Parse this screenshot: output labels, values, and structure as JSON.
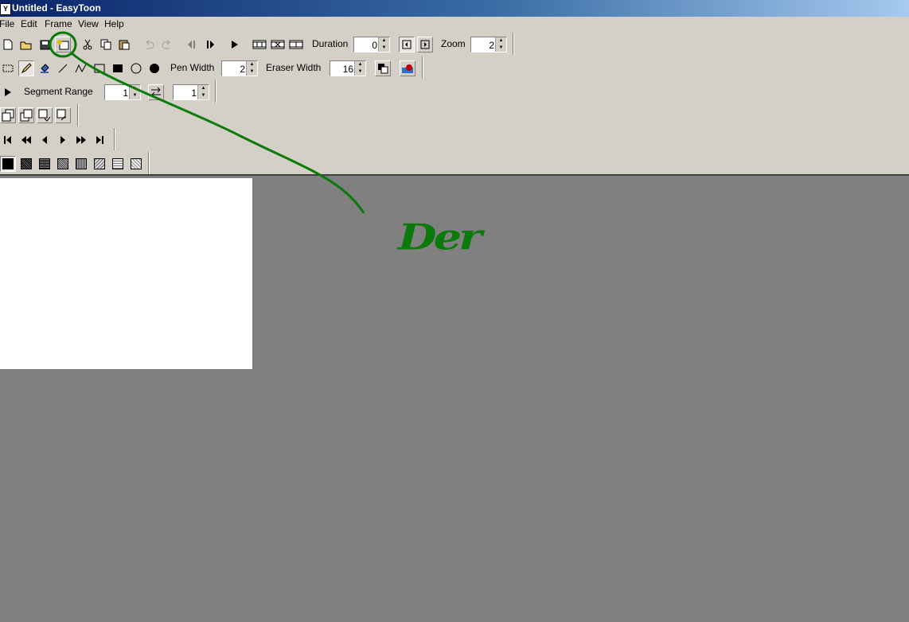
{
  "window": {
    "title": "Untitled - EasyToon",
    "app_icon_glyph": "Y"
  },
  "menu": [
    "File",
    "Edit",
    "Frame",
    "View",
    "Help"
  ],
  "toolbar_main": {
    "duration_label": "Duration",
    "duration_value": "0",
    "zoom_label": "Zoom",
    "zoom_value": "2",
    "icons": [
      "new-file-icon",
      "open-folder-icon",
      "save-icon",
      "export-icon",
      "cut-icon",
      "copy-icon",
      "paste-icon",
      "undo-icon",
      "redo-icon",
      "prev-frame-icon",
      "next-frame-icon",
      "play-icon",
      "frame-strip-icon",
      "frame-strip-icon",
      "frame-strip-icon",
      "onion-left-icon",
      "onion-right-icon"
    ]
  },
  "toolbar_draw": {
    "pen_width_label": "Pen Width",
    "pen_width_value": "2",
    "eraser_width_label": "Eraser Width",
    "eraser_width_value": "16",
    "icons": [
      "select-rect-icon",
      "pencil-icon",
      "fill-bucket-icon",
      "line-icon",
      "polyline-icon",
      "rectangle-outline-icon",
      "rectangle-filled-icon",
      "ellipse-outline-icon",
      "ellipse-filled-icon",
      "swap-colors-icon",
      "color-picker-icon"
    ]
  },
  "toolbar_segment": {
    "segment_label": "Segment Range",
    "start_value": "1",
    "end_value": "1"
  },
  "toolbar_frames": {
    "icons": [
      "insert-frame-icon",
      "delete-frame-icon",
      "copy-frame-icon",
      "paste-frame-icon"
    ]
  },
  "toolbar_nav": {
    "icons": [
      "first-frame-icon",
      "rewind-icon",
      "step-back-icon",
      "step-forward-icon",
      "fast-forward-icon",
      "last-frame-icon"
    ]
  },
  "toolbar_fill": {
    "patterns": [
      "solid",
      "dense-dots",
      "grid",
      "checker",
      "medium-dots",
      "cross",
      "light-grid",
      "sparse-dots"
    ]
  },
  "annotation": {
    "text": "Der",
    "color": "#0a7a0a"
  },
  "colors": {
    "face": "#d4d0c8",
    "workspace": "#808080",
    "canvas": "#ffffff",
    "title_gradient_start": "#0a246a"
  }
}
